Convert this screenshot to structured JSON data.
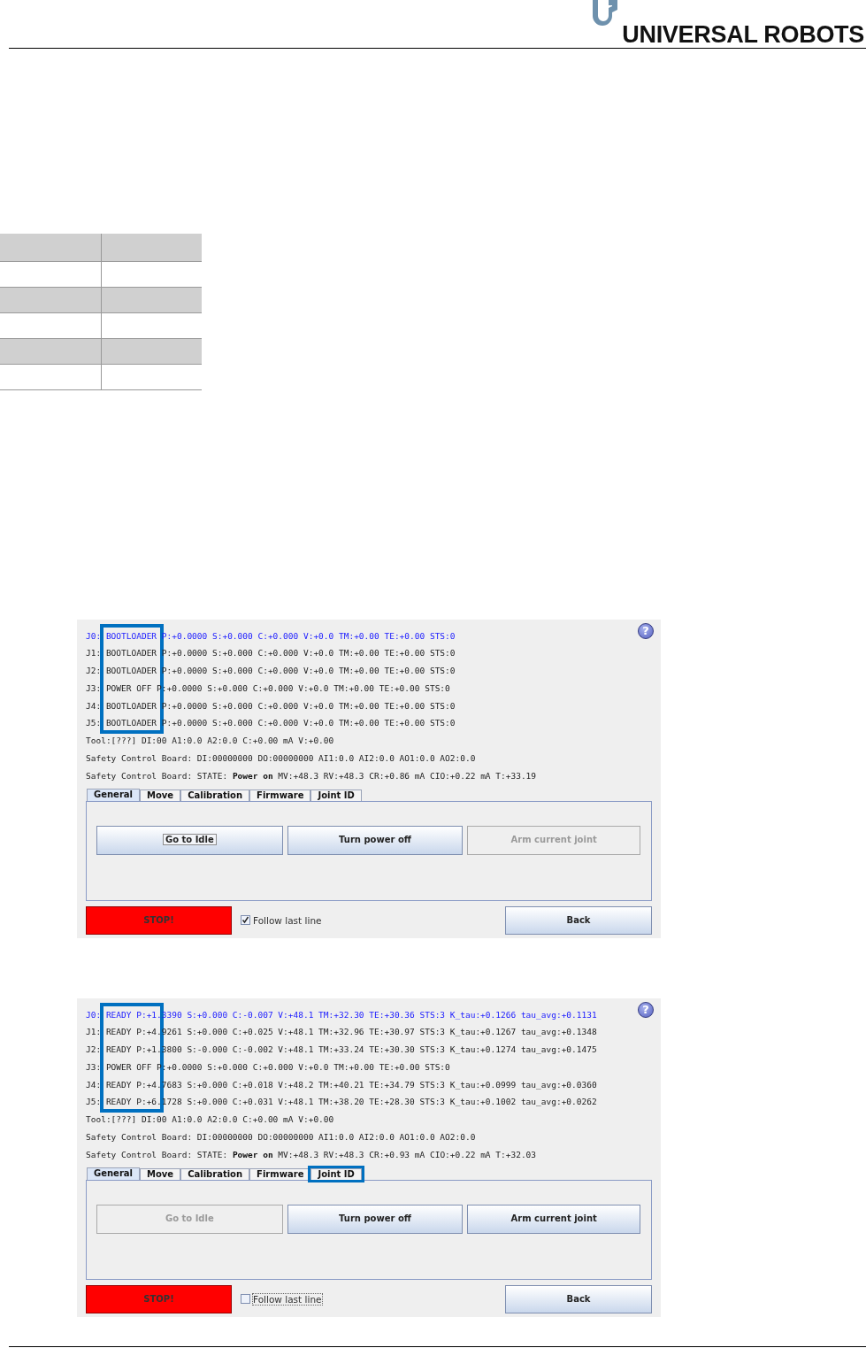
{
  "header": {
    "brand": "UNIVERSAL ROBOTS"
  },
  "table": {
    "rows": [
      {
        "shaded": true
      },
      {
        "shaded": false
      },
      {
        "shaded": true
      },
      {
        "shaded": false
      },
      {
        "shaded": true
      },
      {
        "shaded": false
      }
    ]
  },
  "panels": [
    {
      "help": "?",
      "status_box": true,
      "lines": [
        {
          "text": "J0: BOOTLOADER P:+0.0000 S:+0.000 C:+0.000 V:+0.0 TM:+0.00 TE:+0.00 STS:0",
          "selected": true
        },
        {
          "text": "J1: BOOTLOADER P:+0.0000 S:+0.000 C:+0.000 V:+0.0 TM:+0.00 TE:+0.00 STS:0",
          "selected": false
        },
        {
          "text": "J2: BOOTLOADER P:+0.0000 S:+0.000 C:+0.000 V:+0.0 TM:+0.00 TE:+0.00 STS:0",
          "selected": false
        },
        {
          "text": "J3: POWER OFF P:+0.0000 S:+0.000 C:+0.000 V:+0.0 TM:+0.00 TE:+0.00 STS:0",
          "selected": false
        },
        {
          "text": "J4: BOOTLOADER P:+0.0000 S:+0.000 C:+0.000 V:+0.0 TM:+0.00 TE:+0.00 STS:0",
          "selected": false
        },
        {
          "text": "J5: BOOTLOADER P:+0.0000 S:+0.000 C:+0.000 V:+0.0 TM:+0.00 TE:+0.00 STS:0",
          "selected": false
        },
        {
          "text": "Tool:[???] DI:00  A1:0.0 A2:0.0 C:+0.00 mA V:+0.00",
          "selected": false
        },
        {
          "text": "Safety Control Board: DI:00000000 DO:00000000 AI1:0.0 AI2:0.0 AO1:0.0 AO2:0.0",
          "selected": false
        },
        {
          "text": "Safety Control Board: STATE: **Power on** MV:+48.3 RV:+48.3 CR:+0.86 mA CIO:+0.22 mA T:+33.19",
          "selected": false
        }
      ],
      "tabs": [
        {
          "label": "General",
          "selected": true,
          "highlighted": false
        },
        {
          "label": "Move",
          "selected": false,
          "highlighted": false
        },
        {
          "label": "Calibration",
          "selected": false,
          "highlighted": false
        },
        {
          "label": "Firmware",
          "selected": false,
          "highlighted": false
        },
        {
          "label": "Joint ID",
          "selected": false,
          "highlighted": false
        }
      ],
      "buttons": [
        {
          "label": "Go to Idle",
          "disabled": false,
          "focused": true
        },
        {
          "label": "Turn power off",
          "disabled": false,
          "focused": false
        },
        {
          "label": "Arm current joint",
          "disabled": true,
          "focused": false
        }
      ],
      "stop": "STOP!",
      "follow": {
        "label": "Follow last line",
        "checked": true,
        "focused": false
      },
      "back": "Back"
    },
    {
      "help": "?",
      "status_box": true,
      "lines": [
        {
          "text": "J0: READY P:+1.3390 S:+0.000 C:-0.007 V:+48.1 TM:+32.30 TE:+30.36 STS:3 K_tau:+0.1266 tau_avg:+0.1131",
          "selected": true
        },
        {
          "text": "J1: READY P:+4.9261 S:+0.000 C:+0.025 V:+48.1 TM:+32.96 TE:+30.97 STS:3 K_tau:+0.1267 tau_avg:+0.1348",
          "selected": false
        },
        {
          "text": "J2: READY P:+1.3800 S:-0.000 C:-0.002 V:+48.1 TM:+33.24 TE:+30.30 STS:3 K_tau:+0.1274 tau_avg:+0.1475",
          "selected": false
        },
        {
          "text": "J3: POWER OFF P:+0.0000 S:+0.000 C:+0.000 V:+0.0 TM:+0.00 TE:+0.00 STS:0",
          "selected": false
        },
        {
          "text": "J4: READY P:+4.7683 S:+0.000 C:+0.018 V:+48.2 TM:+40.21 TE:+34.79 STS:3 K_tau:+0.0999 tau_avg:+0.0360",
          "selected": false
        },
        {
          "text": "J5: READY P:+6.1728 S:+0.000 C:+0.031 V:+48.1 TM:+38.20 TE:+28.30 STS:3 K_tau:+0.1002 tau_avg:+0.0262",
          "selected": false
        },
        {
          "text": "Tool:[???] DI:00  A1:0.0 A2:0.0 C:+0.00 mA V:+0.00",
          "selected": false
        },
        {
          "text": "Safety Control Board: DI:00000000 DO:00000000 AI1:0.0 AI2:0.0 AO1:0.0 AO2:0.0",
          "selected": false
        },
        {
          "text": "Safety Control Board: STATE: **Power on** MV:+48.3 RV:+48.3 CR:+0.93 mA CIO:+0.22 mA T:+32.03",
          "selected": false
        }
      ],
      "tabs": [
        {
          "label": "General",
          "selected": true,
          "highlighted": false
        },
        {
          "label": "Move",
          "selected": false,
          "highlighted": false
        },
        {
          "label": "Calibration",
          "selected": false,
          "highlighted": false
        },
        {
          "label": "Firmware",
          "selected": false,
          "highlighted": false
        },
        {
          "label": "Joint ID",
          "selected": false,
          "highlighted": true
        }
      ],
      "buttons": [
        {
          "label": "Go to Idle",
          "disabled": true,
          "focused": false
        },
        {
          "label": "Turn power off",
          "disabled": false,
          "focused": false
        },
        {
          "label": "Arm current joint",
          "disabled": false,
          "focused": false
        }
      ],
      "stop": "STOP!",
      "follow": {
        "label": "Follow last line",
        "checked": false,
        "focused": true
      },
      "back": "Back"
    }
  ]
}
